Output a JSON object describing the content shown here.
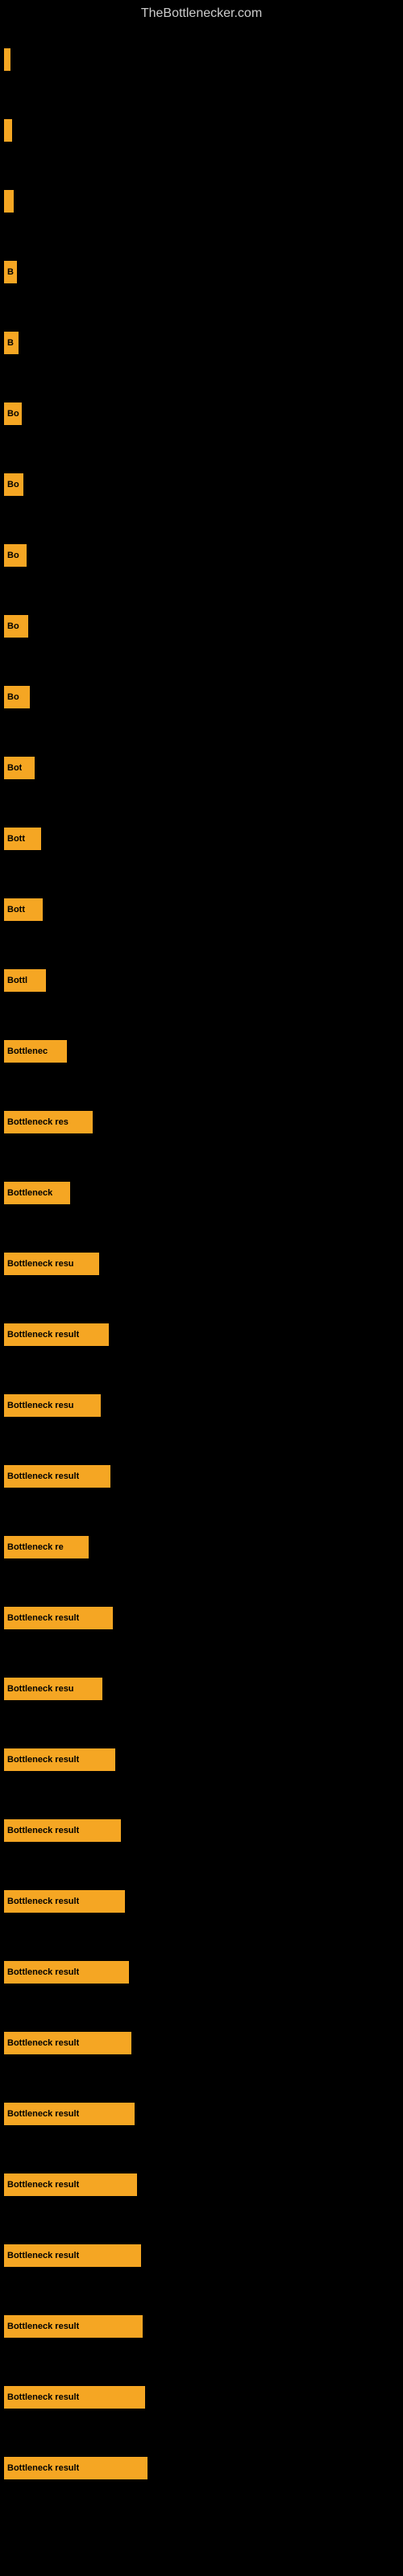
{
  "site": {
    "title": "TheBottlenecker.com"
  },
  "bars": [
    {
      "id": 1,
      "label": "",
      "width": 8
    },
    {
      "id": 2,
      "label": "",
      "width": 10
    },
    {
      "id": 3,
      "label": "",
      "width": 12
    },
    {
      "id": 4,
      "label": "B",
      "width": 16
    },
    {
      "id": 5,
      "label": "B",
      "width": 18
    },
    {
      "id": 6,
      "label": "Bo",
      "width": 22
    },
    {
      "id": 7,
      "label": "Bo",
      "width": 24
    },
    {
      "id": 8,
      "label": "Bo",
      "width": 28
    },
    {
      "id": 9,
      "label": "Bo",
      "width": 30
    },
    {
      "id": 10,
      "label": "Bo",
      "width": 32
    },
    {
      "id": 11,
      "label": "Bot",
      "width": 38
    },
    {
      "id": 12,
      "label": "Bott",
      "width": 46
    },
    {
      "id": 13,
      "label": "Bott",
      "width": 48
    },
    {
      "id": 14,
      "label": "Bottl",
      "width": 52
    },
    {
      "id": 15,
      "label": "Bottlenec",
      "width": 78
    },
    {
      "id": 16,
      "label": "Bottleneck res",
      "width": 110
    },
    {
      "id": 17,
      "label": "Bottleneck",
      "width": 82
    },
    {
      "id": 18,
      "label": "Bottleneck resu",
      "width": 118
    },
    {
      "id": 19,
      "label": "Bottleneck result",
      "width": 130
    },
    {
      "id": 20,
      "label": "Bottleneck resu",
      "width": 120
    },
    {
      "id": 21,
      "label": "Bottleneck result",
      "width": 132
    },
    {
      "id": 22,
      "label": "Bottleneck re",
      "width": 105
    },
    {
      "id": 23,
      "label": "Bottleneck result",
      "width": 135
    },
    {
      "id": 24,
      "label": "Bottleneck resu",
      "width": 122
    },
    {
      "id": 25,
      "label": "Bottleneck result",
      "width": 138
    },
    {
      "id": 26,
      "label": "Bottleneck result",
      "width": 145
    },
    {
      "id": 27,
      "label": "Bottleneck result",
      "width": 150
    },
    {
      "id": 28,
      "label": "Bottleneck result",
      "width": 155
    },
    {
      "id": 29,
      "label": "Bottleneck result",
      "width": 158
    },
    {
      "id": 30,
      "label": "Bottleneck result",
      "width": 162
    },
    {
      "id": 31,
      "label": "Bottleneck result",
      "width": 165
    },
    {
      "id": 32,
      "label": "Bottleneck result",
      "width": 170
    },
    {
      "id": 33,
      "label": "Bottleneck result",
      "width": 172
    },
    {
      "id": 34,
      "label": "Bottleneck result",
      "width": 175
    },
    {
      "id": 35,
      "label": "Bottleneck result",
      "width": 178
    }
  ]
}
